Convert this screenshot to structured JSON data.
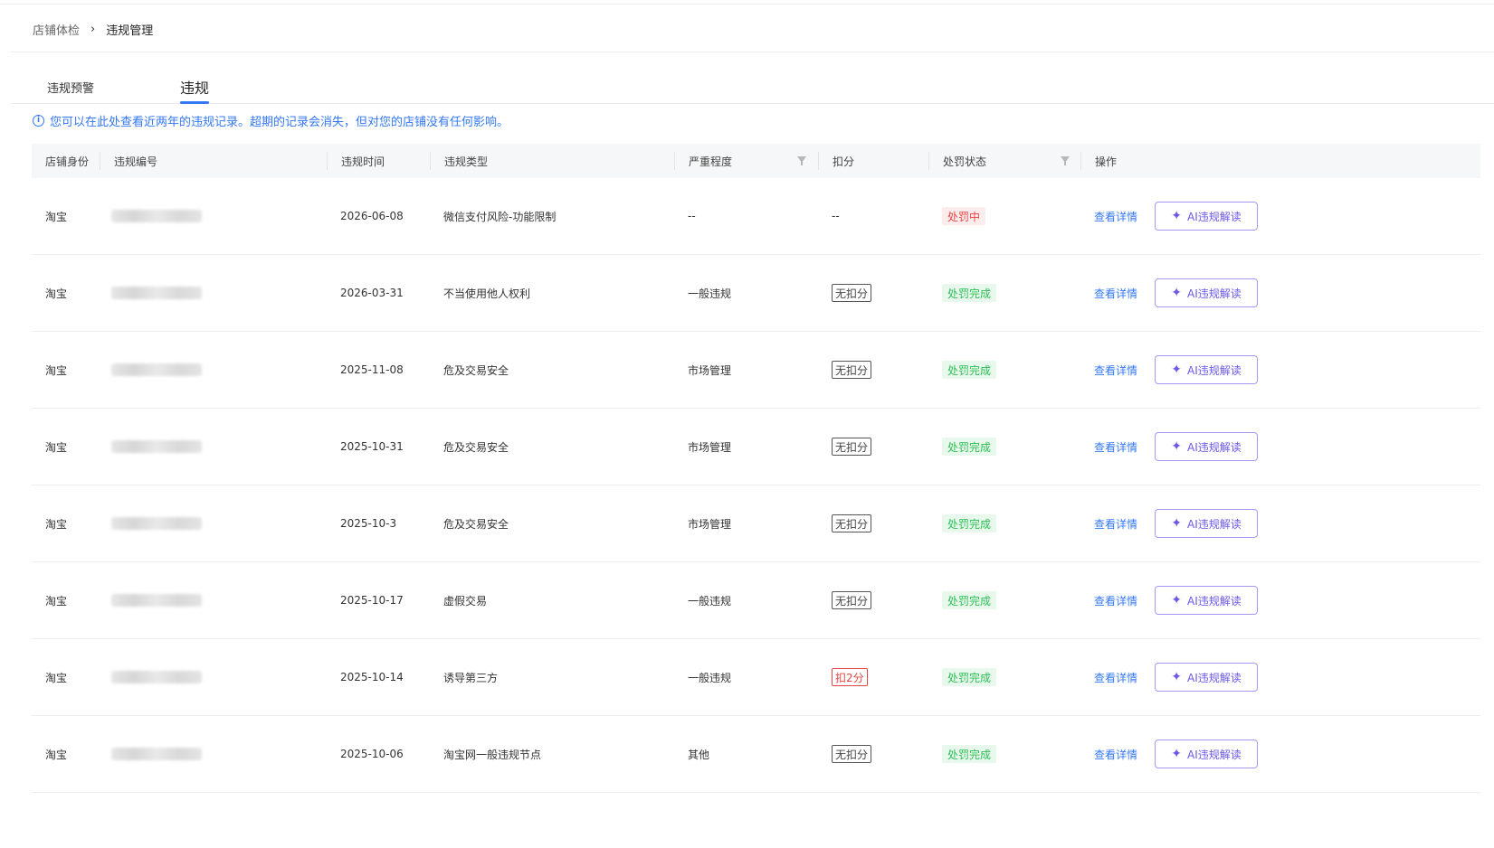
{
  "breadcrumb": {
    "parent": "店铺体检",
    "separator": "›",
    "current": "违规管理"
  },
  "tabs": [
    {
      "label": "违规预警"
    },
    {
      "label": "违规"
    }
  ],
  "notice": {
    "icon": "info-icon",
    "text": "您可以在此处查看近两年的违规记录。超期的记录会消失，但对您的店铺没有任何影响。"
  },
  "table": {
    "headers": {
      "identity": "店铺身份",
      "id": "违规编号",
      "time": "违规时间",
      "type": "违规类型",
      "severity": "严重程度",
      "deduct": "扣分",
      "status": "处罚状态",
      "action": "操作"
    },
    "rows": [
      {
        "identity": "淘宝",
        "time": "2026-06-08",
        "type": "微信支付风险-功能限制",
        "severity": "--",
        "deduct": "--",
        "deduct_style": "plain",
        "status": "处罚中",
        "status_style": "red"
      },
      {
        "identity": "淘宝",
        "time": "2026-03-31",
        "type": "不当使用他人权利",
        "severity": "一般违规",
        "deduct": "无扣分",
        "deduct_style": "outline",
        "status": "处罚完成",
        "status_style": "green"
      },
      {
        "identity": "淘宝",
        "time": "2025-11-08",
        "type": "危及交易安全",
        "severity": "市场管理",
        "deduct": "无扣分",
        "deduct_style": "outline",
        "status": "处罚完成",
        "status_style": "green"
      },
      {
        "identity": "淘宝",
        "time": "2025-10-31",
        "type": "危及交易安全",
        "severity": "市场管理",
        "deduct": "无扣分",
        "deduct_style": "outline",
        "status": "处罚完成",
        "status_style": "green"
      },
      {
        "identity": "淘宝",
        "time": "2025-10-3",
        "type": "危及交易安全",
        "severity": "市场管理",
        "deduct": "无扣分",
        "deduct_style": "outline",
        "status": "处罚完成",
        "status_style": "green"
      },
      {
        "identity": "淘宝",
        "time": "2025-10-17",
        "type": "虚假交易",
        "severity": "一般违规",
        "deduct": "无扣分",
        "deduct_style": "outline",
        "status": "处罚完成",
        "status_style": "green"
      },
      {
        "identity": "淘宝",
        "time": "2025-10-14",
        "type": "诱导第三方",
        "severity": "一般违规",
        "deduct": "扣2分",
        "deduct_style": "outline-red",
        "status": "处罚完成",
        "status_style": "green"
      },
      {
        "identity": "淘宝",
        "time": "2025-10-06",
        "type": "淘宝网一般违规节点",
        "severity": "其他",
        "deduct": "无扣分",
        "deduct_style": "outline",
        "status": "处罚完成",
        "status_style": "green"
      }
    ],
    "actions": {
      "detail": "查看详情",
      "ai": "AI违规解读",
      "ai_icon": "sparkle-icon"
    }
  },
  "colors": {
    "accent": "#3478f6",
    "ai_purple": "#6a58e8",
    "danger": "#e54545",
    "success": "#2bbf56"
  }
}
